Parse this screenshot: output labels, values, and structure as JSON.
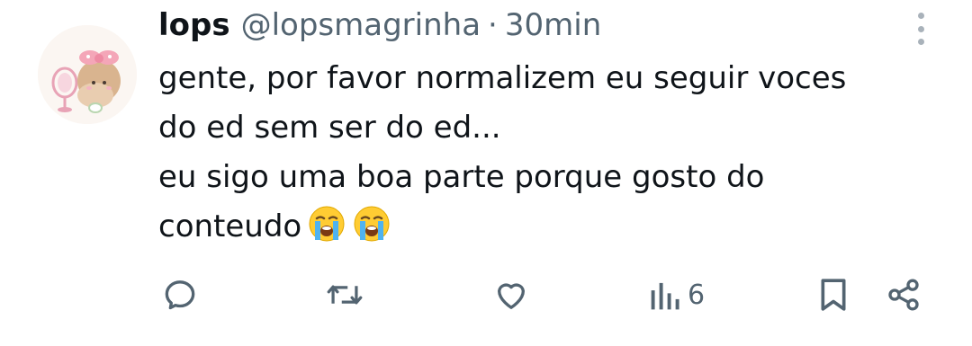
{
  "tweet": {
    "display_name": "lops",
    "handle": "@lopsmagrinha",
    "separator": "·",
    "time": "30min",
    "lines": [
      "gente, por favor normalizem eu seguir voces",
      "do ed sem ser do ed...",
      "eu sigo uma boa parte porque gosto do",
      "conteudo"
    ],
    "emojis": [
      "loudly-crying-face",
      "loudly-crying-face"
    ]
  },
  "actions": {
    "reply_icon": "reply-icon",
    "retweet_icon": "retweet-icon",
    "like_icon": "heart-icon",
    "views_icon": "views-chart-icon",
    "views_count": "6",
    "bookmark_icon": "bookmark-icon",
    "share_icon": "share-icon"
  },
  "colors": {
    "text": "#0f1419",
    "secondary": "#536471",
    "more_dots": "#a9b2ba",
    "avatar_accent": "#f4a6b8"
  }
}
